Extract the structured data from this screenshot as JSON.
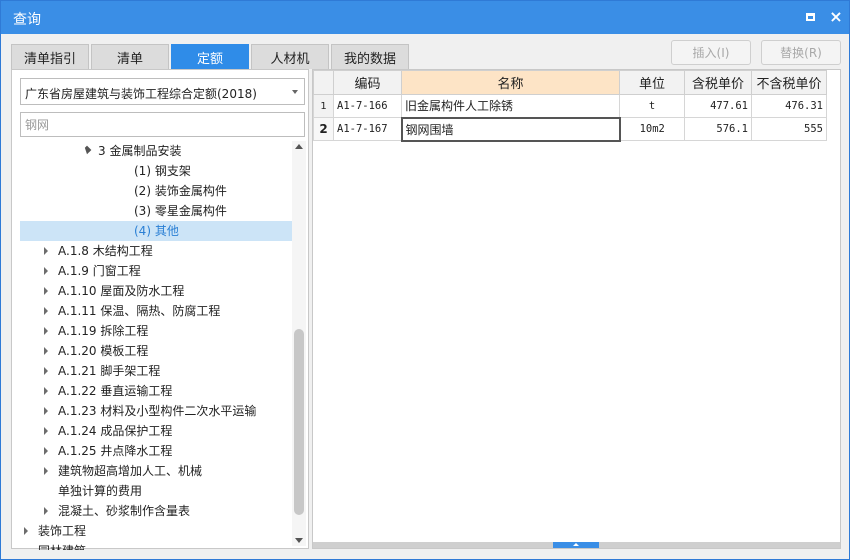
{
  "window": {
    "title": "查询",
    "maximize_icon": "maximize-icon",
    "close_icon": "close-icon",
    "close_glyph": "×"
  },
  "tabs": [
    {
      "label": "清单指引",
      "active": false
    },
    {
      "label": "清单",
      "active": false
    },
    {
      "label": "定额",
      "active": true
    },
    {
      "label": "人材机",
      "active": false
    },
    {
      "label": "我的数据",
      "active": false
    }
  ],
  "actions": {
    "insert_label": "插入(I)",
    "replace_label": "替换(R)"
  },
  "left": {
    "library_select": "广东省房屋建筑与装饰工程综合定额(2018)",
    "search_value": "钢网",
    "tree": [
      {
        "label": "3 金属制品安装",
        "level": 2,
        "expander": "down"
      },
      {
        "label": "(1) 钢支架",
        "level": 3,
        "expander": "none"
      },
      {
        "label": "(2) 装饰金属构件",
        "level": 3,
        "expander": "none"
      },
      {
        "label": "(3) 零星金属构件",
        "level": 3,
        "expander": "none"
      },
      {
        "label": "(4) 其他",
        "level": 3,
        "expander": "none",
        "selected": true
      },
      {
        "label": "A.1.8 木结构工程",
        "level": 1,
        "expander": "right"
      },
      {
        "label": "A.1.9 门窗工程",
        "level": 1,
        "expander": "right"
      },
      {
        "label": "A.1.10 屋面及防水工程",
        "level": 1,
        "expander": "right"
      },
      {
        "label": "A.1.11 保温、隔热、防腐工程",
        "level": 1,
        "expander": "right"
      },
      {
        "label": "A.1.19 拆除工程",
        "level": 1,
        "expander": "right"
      },
      {
        "label": "A.1.20 模板工程",
        "level": 1,
        "expander": "right"
      },
      {
        "label": "A.1.21 脚手架工程",
        "level": 1,
        "expander": "right"
      },
      {
        "label": "A.1.22 垂直运输工程",
        "level": 1,
        "expander": "right"
      },
      {
        "label": "A.1.23 材料及小型构件二次水平运输",
        "level": 1,
        "expander": "right"
      },
      {
        "label": "A.1.24 成品保护工程",
        "level": 1,
        "expander": "right"
      },
      {
        "label": "A.1.25 井点降水工程",
        "level": 1,
        "expander": "right"
      },
      {
        "label": "建筑物超高增加人工、机械",
        "level": 1,
        "expander": "right"
      },
      {
        "label": "单独计算的费用",
        "level": 1,
        "expander": "none"
      },
      {
        "label": "混凝土、砂浆制作含量表",
        "level": 1,
        "expander": "right"
      },
      {
        "label": "装饰工程",
        "level": 0,
        "expander": "right"
      },
      {
        "label": "园林建筑",
        "level": 0,
        "expander": "none"
      }
    ]
  },
  "grid": {
    "columns": [
      "编码",
      "名称",
      "单位",
      "含税单价",
      "不含税单价"
    ],
    "rows": [
      {
        "no": "1",
        "code": "A1-7-166",
        "name": "旧金属构件人工除锈",
        "unit": "t",
        "price_tax": "477.61",
        "price_notax": "476.31"
      },
      {
        "no": "2",
        "code": "A1-7-167",
        "name": "钢网围墙",
        "unit": "10m2",
        "price_tax": "576.1",
        "price_notax": "555"
      }
    ]
  }
}
